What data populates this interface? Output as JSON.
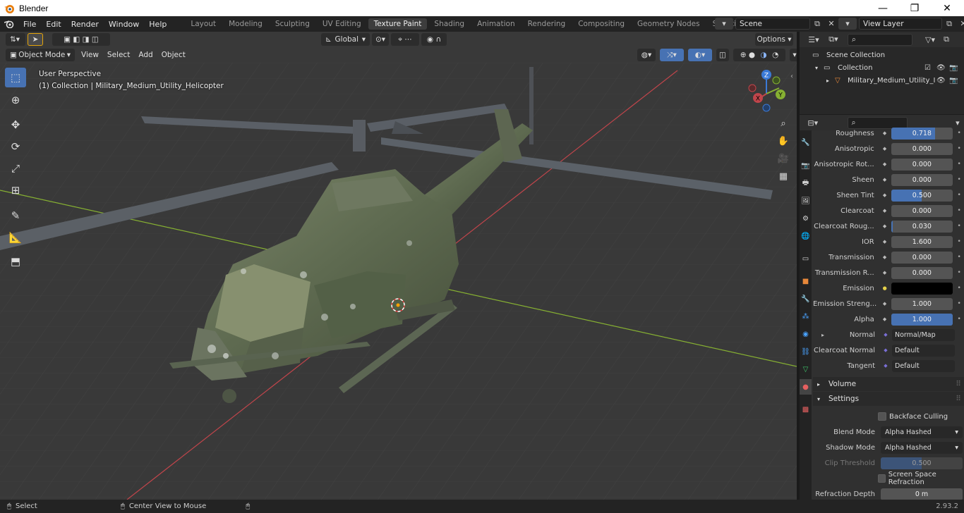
{
  "window": {
    "title": "Blender",
    "minimize": "—",
    "maximize": "❐",
    "close": "✕"
  },
  "menu": [
    "File",
    "Edit",
    "Render",
    "Window",
    "Help"
  ],
  "workspaces": {
    "tabs": [
      "Layout",
      "Modeling",
      "Sculpting",
      "UV Editing",
      "Texture Paint",
      "Shading",
      "Animation",
      "Rendering",
      "Compositing",
      "Geometry Nodes",
      "Scripting"
    ],
    "active": "Texture Paint",
    "add": "+"
  },
  "scene": {
    "name": "Scene",
    "view_layer": "View Layer"
  },
  "viewport": {
    "mode": "Object Mode",
    "menus": [
      "View",
      "Select",
      "Add",
      "Object"
    ],
    "transform_orientation": "Global",
    "options_label": "Options",
    "perspective_label": "User Perspective",
    "collection_label": "(1) Collection | Military_Medium_Utility_Helicopter"
  },
  "gizmo": {
    "z": "Z",
    "y": "Y",
    "x": "X"
  },
  "outliner": {
    "scene_collection": "Scene Collection",
    "collection": "Collection",
    "object": "Military_Medium_Utility_I"
  },
  "properties": {
    "rows": [
      {
        "label": "Roughness",
        "value": "0.718",
        "fill": 0.718
      },
      {
        "label": "Anisotropic",
        "value": "0.000",
        "fill": 0
      },
      {
        "label": "Anisotropic Rot...",
        "value": "0.000",
        "fill": 0
      },
      {
        "label": "Sheen",
        "value": "0.000",
        "fill": 0
      },
      {
        "label": "Sheen Tint",
        "value": "0.500",
        "fill": 0.5
      },
      {
        "label": "Clearcoat",
        "value": "0.000",
        "fill": 0
      },
      {
        "label": "Clearcoat Roug...",
        "value": "0.030",
        "fill": 0.03
      },
      {
        "label": "IOR",
        "value": "1.600",
        "fill": 0
      },
      {
        "label": "Transmission",
        "value": "0.000",
        "fill": 0
      },
      {
        "label": "Transmission R...",
        "value": "0.000",
        "fill": 0
      },
      {
        "label": "Emission",
        "value": "",
        "fill": 0
      },
      {
        "label": "Emission Streng...",
        "value": "1.000",
        "fill": 0
      },
      {
        "label": "Alpha",
        "value": "1.000",
        "fill": 1
      }
    ],
    "normal_label": "Normal",
    "normal_value": "Normal/Map",
    "clearcoat_normal_label": "Clearcoat Normal",
    "clearcoat_normal_value": "Default",
    "tangent_label": "Tangent",
    "tangent_value": "Default",
    "volume_panel": "Volume",
    "settings_panel": "Settings",
    "backface_culling": "Backface Culling",
    "blend_mode_label": "Blend Mode",
    "blend_mode_value": "Alpha Hashed",
    "shadow_mode_label": "Shadow Mode",
    "shadow_mode_value": "Alpha Hashed",
    "clip_threshold_label": "Clip Threshold",
    "clip_threshold_value": "0.500",
    "ssr_label": "Screen Space Refraction",
    "refraction_depth_label": "Refraction Depth",
    "refraction_depth_value": "0 m"
  },
  "statusbar": {
    "select": "Select",
    "center_view": "Center View to Mouse",
    "version": "2.93.2"
  },
  "colors": {
    "accent": "#4772b3",
    "viewport_bg": "#393939",
    "x_axis": "#c0454b",
    "y_axis": "#86b032",
    "z_axis": "#3b7ad6",
    "emission_swatch": "#000000",
    "helicopter_body": "#616b52"
  }
}
